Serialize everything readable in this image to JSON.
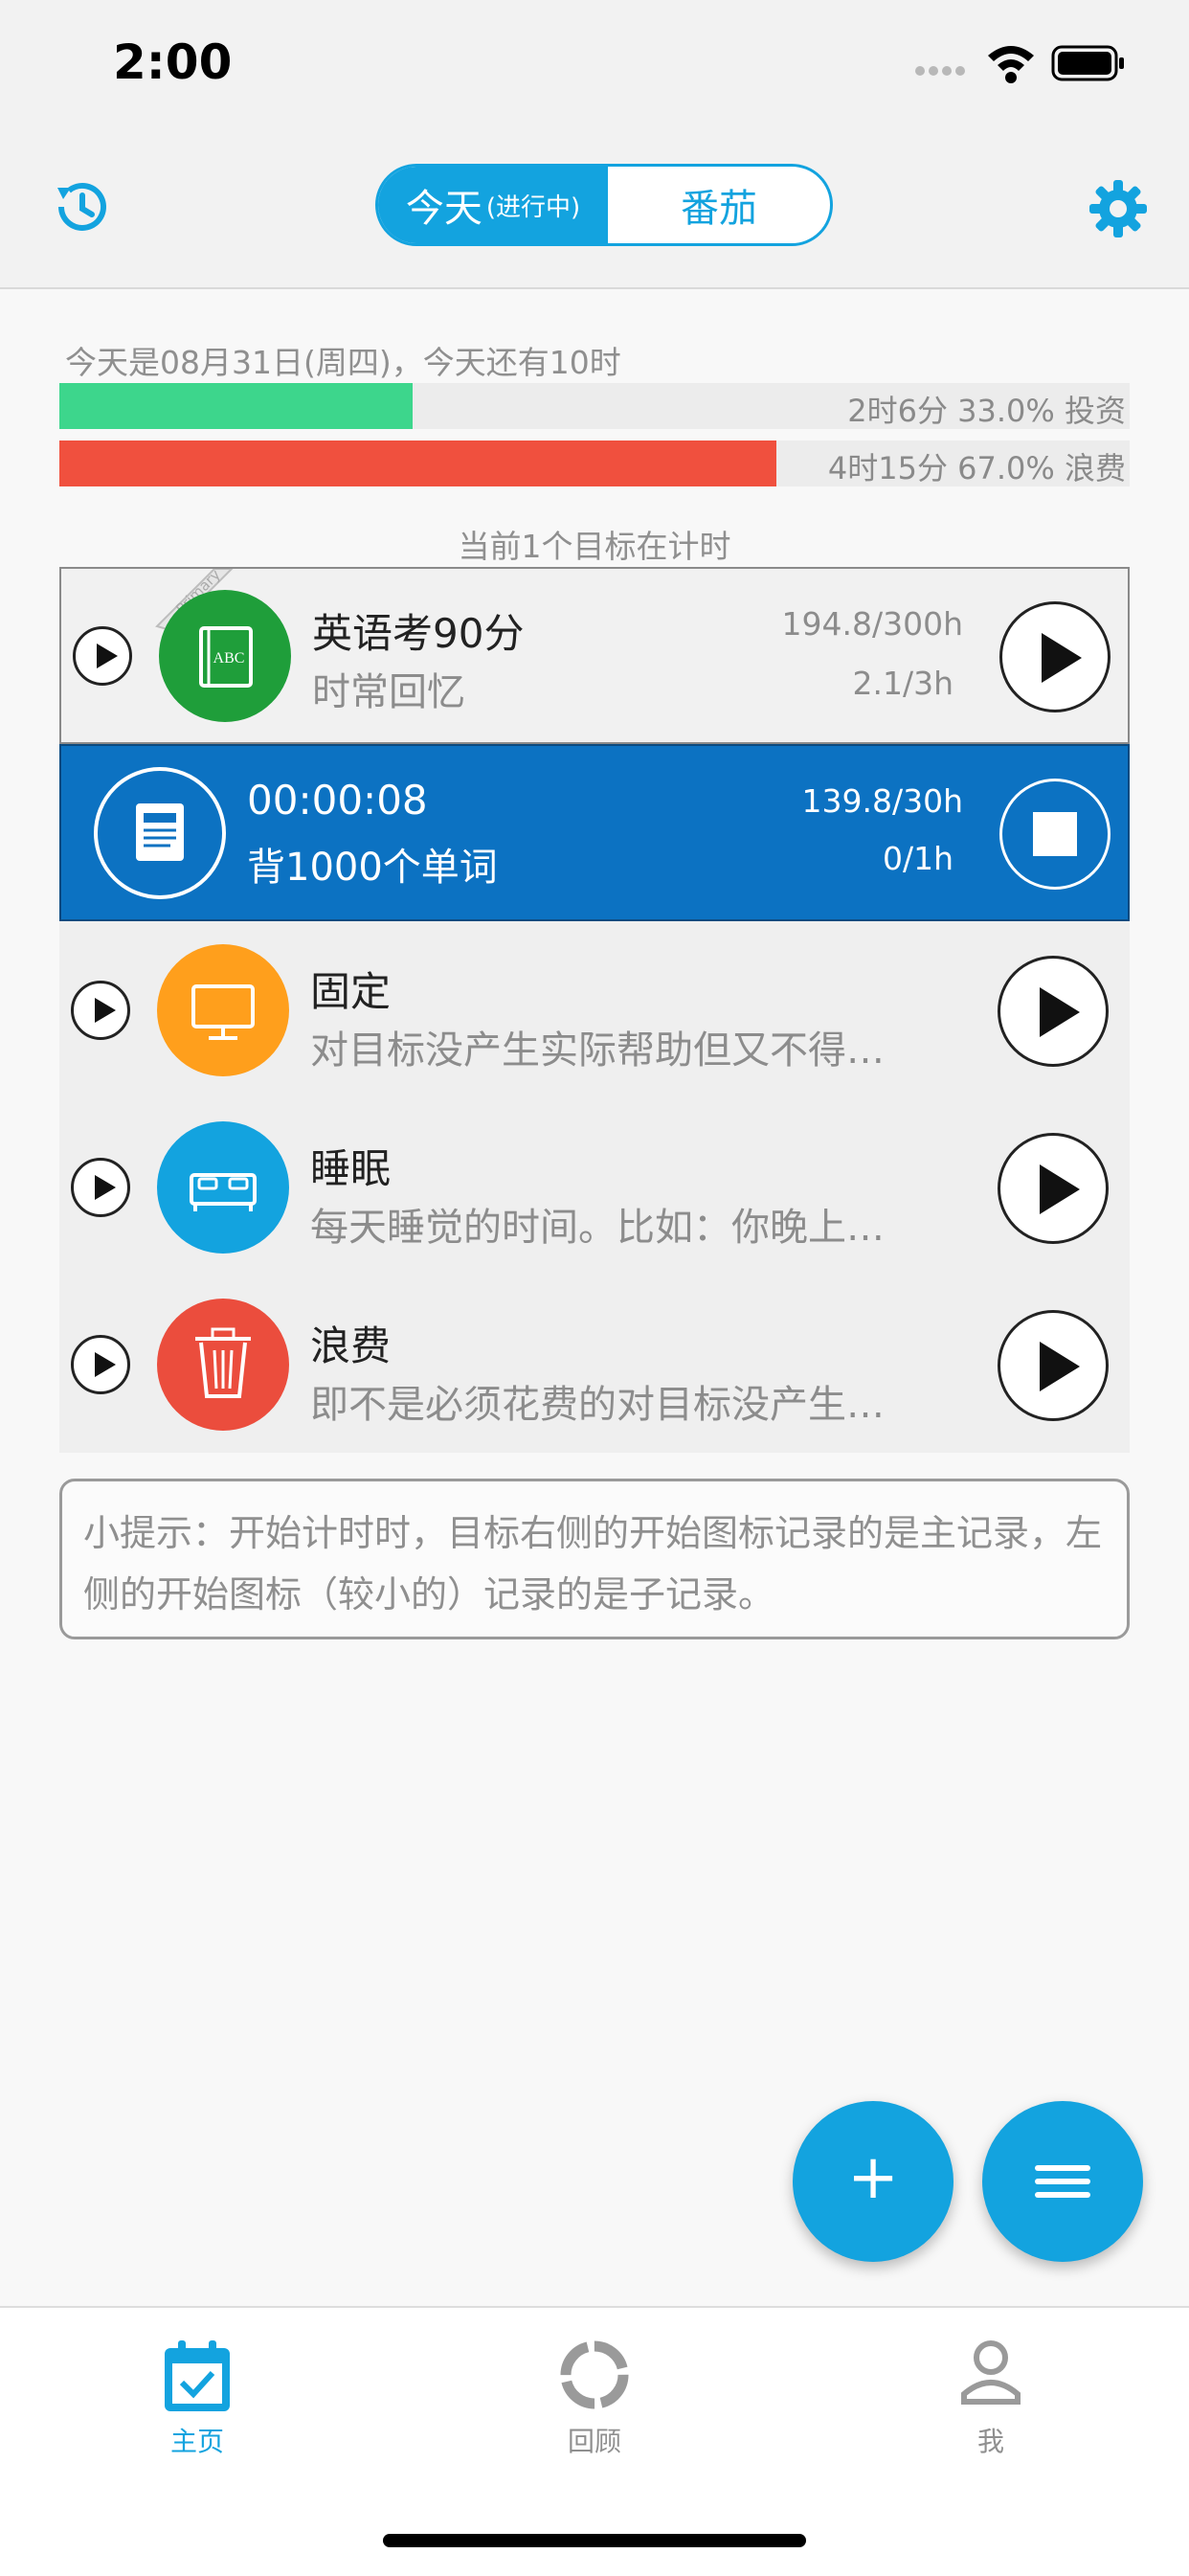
{
  "status_bar": {
    "time": "2:00"
  },
  "header": {
    "segment": {
      "active_label": "今天",
      "active_sub": "(进行中)",
      "inactive_label": "番茄"
    },
    "left_icon": "history-icon",
    "right_icon": "gear-icon"
  },
  "summary": {
    "date_text": "今天是08月31日(周四)，今天还有10时",
    "invest": {
      "label": "2时6分 33.0% 投资",
      "fraction": 0.33,
      "color": "#3dd68c"
    },
    "waste": {
      "label": "4时15分 67.0% 浪费",
      "fraction": 0.67,
      "color": "#f0503e"
    }
  },
  "timer_status": "当前1个目标在计时",
  "goals": [
    {
      "title": "英语考90分",
      "subtitle": "时常回忆",
      "stat1": "194.8/300h",
      "stat2": "2.1/3h",
      "badge": "Primary",
      "icon": "book-abc-icon",
      "color": "#1f9e3a"
    },
    {
      "title": "00:00:08",
      "subtitle": "背1000个单词",
      "stat1": "139.8/30h",
      "stat2": "0/1h",
      "icon": "notebook-icon",
      "color": "#0c72c2",
      "running": true
    },
    {
      "title": "固定",
      "subtitle": "对目标没产生实际帮助但又不得…",
      "icon": "monitor-icon",
      "color": "#ff9f1c"
    },
    {
      "title": "睡眠",
      "subtitle": "每天睡觉的时间。比如：你晚上…",
      "icon": "bed-icon",
      "color": "#13a3df"
    },
    {
      "title": "浪费",
      "subtitle": "即不是必须花费的对目标没产生…",
      "icon": "trash-icon",
      "color": "#eb4d3d"
    }
  ],
  "tip": "小提示：开始计时时，目标右侧的开始图标记录的是主记录，左侧的开始图标（较小的）记录的是子记录。",
  "fabs": {
    "add": "+",
    "menu": "≡"
  },
  "tabs": [
    {
      "label": "主页",
      "icon": "calendar-check-icon",
      "active": true
    },
    {
      "label": "回顾",
      "icon": "review-ring-icon",
      "active": false
    },
    {
      "label": "我",
      "icon": "person-icon",
      "active": false
    }
  ]
}
